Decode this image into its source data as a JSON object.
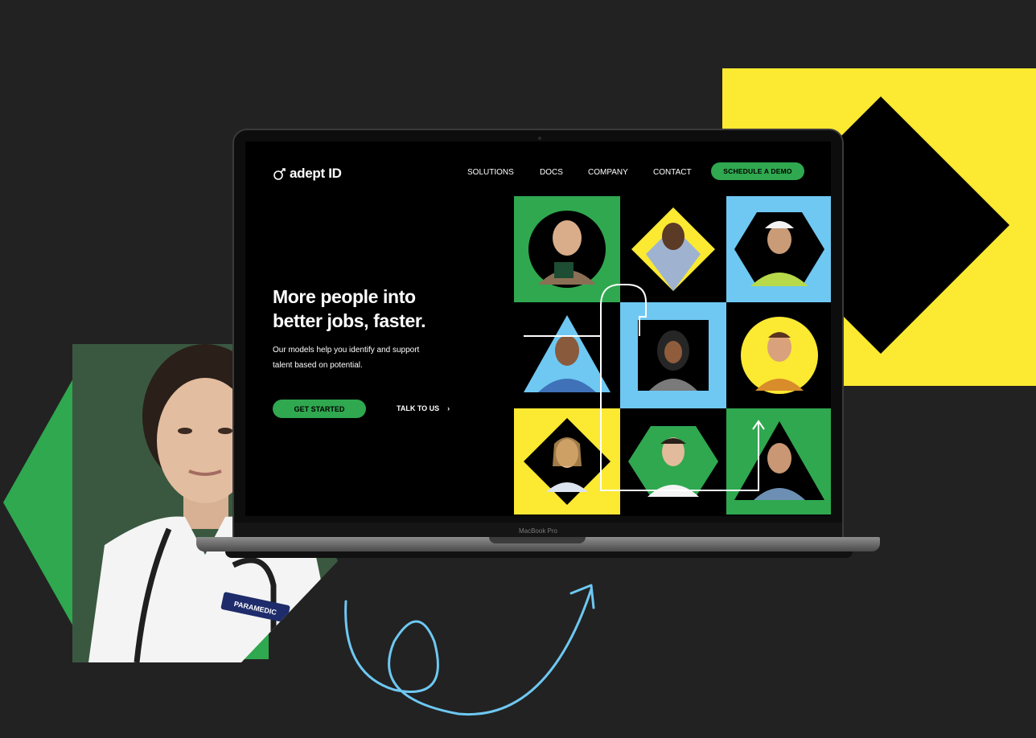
{
  "brand": {
    "name": "adept ID",
    "accent_green": "#2fa84f",
    "accent_yellow": "#fbe932",
    "accent_blue": "#6ec8f2"
  },
  "nav": {
    "items": [
      "SOLUTIONS",
      "DOCS",
      "COMPANY",
      "CONTACT"
    ],
    "cta_label": "SCHEDULE A DEMO"
  },
  "hero": {
    "title_line1": "More people into",
    "title_line2": "better jobs, faster.",
    "subtitle_line1": "Our models help you identify and support",
    "subtitle_line2": "talent based on potential.",
    "primary_cta": "GET STARTED",
    "secondary_cta": "TALK TO US",
    "secondary_cta_icon": "chevron-right-icon"
  },
  "device": {
    "model_label": "MacBook Pro"
  },
  "badge": {
    "text": "PARAMEDIC"
  },
  "portrait_grid": [
    {
      "bg": "#2fa84f",
      "shape": "circle",
      "person": "woman-with-folder"
    },
    {
      "bg": "#000000",
      "shape": "diamond-yellow",
      "person": "man-blue-shirt"
    },
    {
      "bg": "#6ec8f2",
      "shape": "hexagon",
      "person": "construction-worker"
    },
    {
      "bg": "#000000",
      "shape": "triangle-blue",
      "person": "man-scrubs"
    },
    {
      "bg": "#6ec8f2",
      "shape": "square",
      "person": "woman-hijab"
    },
    {
      "bg": "#000000",
      "shape": "circle-yellow",
      "person": "woman-apron"
    },
    {
      "bg": "#fbe932",
      "shape": "diamond",
      "person": "woman-blonde"
    },
    {
      "bg": "#000000",
      "shape": "hexagon-green",
      "person": "woman-doctor"
    },
    {
      "bg": "#2fa84f",
      "shape": "triangle",
      "person": "man-smiling"
    }
  ]
}
